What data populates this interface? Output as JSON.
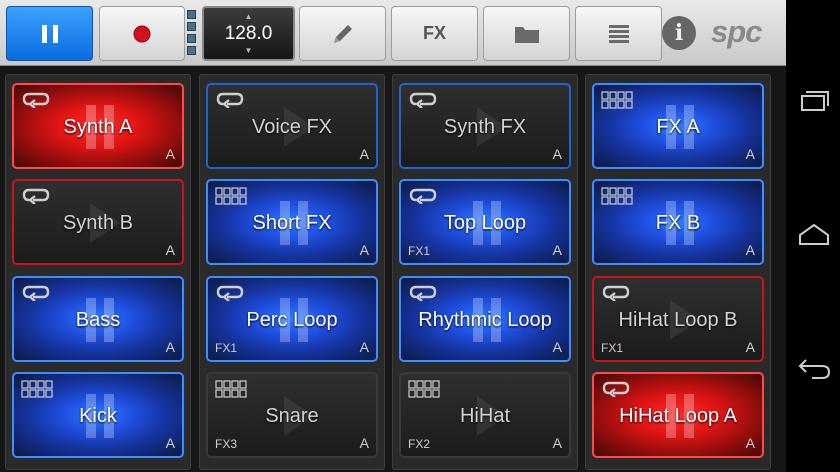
{
  "toolbar": {
    "play_state": "pause",
    "tempo": "128.0",
    "fx_label": "FX",
    "logo": "spc",
    "info_label": "i"
  },
  "pads": [
    [
      {
        "label": "Synth A",
        "bank": "A",
        "fx": "",
        "state": "red",
        "icon": "loop"
      },
      {
        "label": "Synth B",
        "bank": "A",
        "fx": "",
        "state": "red-border",
        "icon": "loop"
      },
      {
        "label": "Bass",
        "bank": "A",
        "fx": "",
        "state": "blue",
        "icon": "loop"
      },
      {
        "label": "Kick",
        "bank": "A",
        "fx": "",
        "state": "blue",
        "icon": "steps"
      }
    ],
    [
      {
        "label": "Voice FX",
        "bank": "A",
        "fx": "",
        "state": "blue-border",
        "icon": "loop"
      },
      {
        "label": "Short FX",
        "bank": "A",
        "fx": "",
        "state": "blue",
        "icon": "steps"
      },
      {
        "label": "Perc Loop",
        "bank": "A",
        "fx": "FX1",
        "state": "blue",
        "icon": "loop"
      },
      {
        "label": "Snare",
        "bank": "A",
        "fx": "FX3",
        "state": "off",
        "icon": "steps"
      }
    ],
    [
      {
        "label": "Synth FX",
        "bank": "A",
        "fx": "",
        "state": "blue-border",
        "icon": "loop"
      },
      {
        "label": "Top Loop",
        "bank": "A",
        "fx": "FX1",
        "state": "blue",
        "icon": "loop"
      },
      {
        "label": "Rhythmic Loop",
        "bank": "A",
        "fx": "",
        "state": "blue",
        "icon": "loop"
      },
      {
        "label": "HiHat",
        "bank": "A",
        "fx": "FX2",
        "state": "off",
        "icon": "steps"
      }
    ],
    [
      {
        "label": "FX A",
        "bank": "A",
        "fx": "",
        "state": "blue",
        "icon": "steps"
      },
      {
        "label": "FX B",
        "bank": "A",
        "fx": "",
        "state": "blue",
        "icon": "steps"
      },
      {
        "label": "HiHat Loop B",
        "bank": "A",
        "fx": "FX1",
        "state": "red-border",
        "icon": "loop"
      },
      {
        "label": "HiHat Loop A",
        "bank": "A",
        "fx": "",
        "state": "red",
        "icon": "loop"
      }
    ]
  ]
}
